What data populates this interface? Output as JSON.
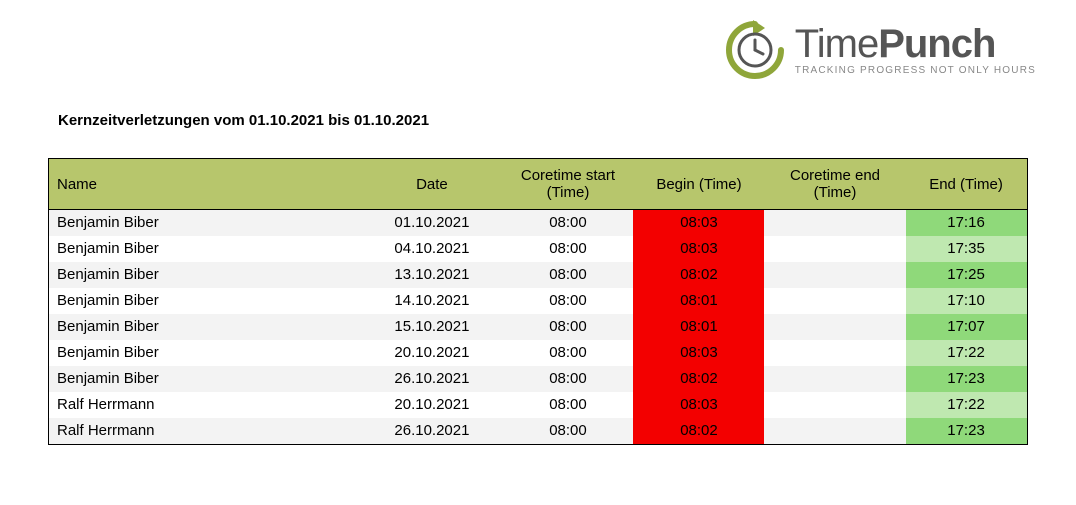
{
  "brand": {
    "name_part1": "Time",
    "name_part2": "Punch",
    "tagline": "TRACKING PROGRESS NOT ONLY HOURS"
  },
  "report": {
    "title": "Kernzeitverletzungen vom 01.10.2021 bis 01.10.2021"
  },
  "table": {
    "headers": {
      "name": "Name",
      "date": "Date",
      "coretime_start": "Coretime start (Time)",
      "begin": "Begin (Time)",
      "coretime_end": "Coretime end (Time)",
      "end": "End (Time)"
    },
    "rows": [
      {
        "name": "Benjamin Biber",
        "date": "01.10.2021",
        "cstart": "08:00",
        "begin": "08:03",
        "cend": "",
        "end": "17:16",
        "end_shade": "dark"
      },
      {
        "name": "Benjamin Biber",
        "date": "04.10.2021",
        "cstart": "08:00",
        "begin": "08:03",
        "cend": "",
        "end": "17:35",
        "end_shade": "light"
      },
      {
        "name": "Benjamin Biber",
        "date": "13.10.2021",
        "cstart": "08:00",
        "begin": "08:02",
        "cend": "",
        "end": "17:25",
        "end_shade": "dark"
      },
      {
        "name": "Benjamin Biber",
        "date": "14.10.2021",
        "cstart": "08:00",
        "begin": "08:01",
        "cend": "",
        "end": "17:10",
        "end_shade": "light"
      },
      {
        "name": "Benjamin Biber",
        "date": "15.10.2021",
        "cstart": "08:00",
        "begin": "08:01",
        "cend": "",
        "end": "17:07",
        "end_shade": "dark"
      },
      {
        "name": "Benjamin Biber",
        "date": "20.10.2021",
        "cstart": "08:00",
        "begin": "08:03",
        "cend": "",
        "end": "17:22",
        "end_shade": "light"
      },
      {
        "name": "Benjamin Biber",
        "date": "26.10.2021",
        "cstart": "08:00",
        "begin": "08:02",
        "cend": "",
        "end": "17:23",
        "end_shade": "dark"
      },
      {
        "name": "Ralf Herrmann",
        "date": "20.10.2021",
        "cstart": "08:00",
        "begin": "08:03",
        "cend": "",
        "end": "17:22",
        "end_shade": "light"
      },
      {
        "name": "Ralf Herrmann",
        "date": "26.10.2021",
        "cstart": "08:00",
        "begin": "08:02",
        "cend": "",
        "end": "17:23",
        "end_shade": "dark"
      }
    ]
  },
  "colors": {
    "header_bg": "#b7c66c",
    "violation_red": "#f30000",
    "end_green_light": "#bfe8b0",
    "end_green_dark": "#8fd97a"
  }
}
